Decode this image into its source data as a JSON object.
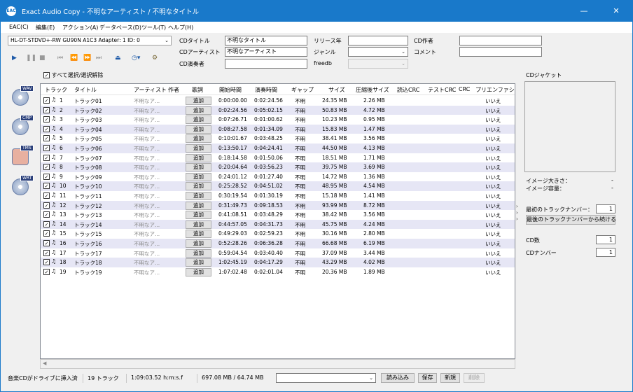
{
  "window": {
    "title": "Exact Audio Copy  -  不明なアーティスト / 不明なタイトル",
    "app_icon_text": "EAC"
  },
  "menu": [
    "EAC(C)",
    "編集(E)",
    "アクション(A)",
    "データベース(D)",
    "ツール(T)",
    "ヘルプ(H)"
  ],
  "drive": {
    "selected": "HL-DT-STDVD+-RW GU90N  A1C3   Adapter: 1  ID: 0"
  },
  "fields": {
    "cd_title_label": "CDタイトル",
    "cd_title_value": "不明なタイトル",
    "cd_artist_label": "CDアーティスト",
    "cd_artist_value": "不明なアーティスト",
    "cd_performer_label": "CD演奏者",
    "cd_performer_value": "",
    "release_year_label": "リリース年",
    "release_year_value": "",
    "genre_label": "ジャンル",
    "genre_value": "",
    "freedb_label": "freedb",
    "freedb_value": "",
    "cd_composer_label": "CD作者",
    "cd_composer_value": "",
    "comment_label": "コメント",
    "comment_value": ""
  },
  "select_all_label": "すべて選択/選択解除",
  "side_icons": [
    {
      "tag": "WAV"
    },
    {
      "tag": "CMP"
    },
    {
      "tag": "TMS"
    },
    {
      "tag": "WRT"
    }
  ],
  "columns": [
    "トラック",
    "タイトル",
    "アーティスト",
    "作者",
    "歌詞",
    "開始時間",
    "演奏時間",
    "ギャップ",
    "サイズ",
    "圧縮後サイズ",
    "読込CRC",
    "テストCRC",
    "CRC",
    "プリエンファシス"
  ],
  "add_label": "追加",
  "tracks": [
    {
      "no": "1",
      "title": "トラック01",
      "artist": "不明なア...",
      "start": "0:00:00.00",
      "length": "0:02:24.56",
      "gap": "不明",
      "size": "24.35 MB",
      "csize": "2.26 MB",
      "pre": "いいえ"
    },
    {
      "no": "2",
      "title": "トラック02",
      "artist": "不明なア...",
      "start": "0:02:24.56",
      "length": "0:05:02.15",
      "gap": "不明",
      "size": "50.83 MB",
      "csize": "4.72 MB",
      "pre": "いいえ"
    },
    {
      "no": "3",
      "title": "トラック03",
      "artist": "不明なア...",
      "start": "0:07:26.71",
      "length": "0:01:00.62",
      "gap": "不明",
      "size": "10.23 MB",
      "csize": "0.95 MB",
      "pre": "いいえ"
    },
    {
      "no": "4",
      "title": "トラック04",
      "artist": "不明なア...",
      "start": "0:08:27.58",
      "length": "0:01:34.09",
      "gap": "不明",
      "size": "15.83 MB",
      "csize": "1.47 MB",
      "pre": "いいえ"
    },
    {
      "no": "5",
      "title": "トラック05",
      "artist": "不明なア...",
      "start": "0:10:01.67",
      "length": "0:03:48.25",
      "gap": "不明",
      "size": "38.41 MB",
      "csize": "3.56 MB",
      "pre": "いいえ"
    },
    {
      "no": "6",
      "title": "トラック06",
      "artist": "不明なア...",
      "start": "0:13:50.17",
      "length": "0:04:24.41",
      "gap": "不明",
      "size": "44.50 MB",
      "csize": "4.13 MB",
      "pre": "いいえ"
    },
    {
      "no": "7",
      "title": "トラック07",
      "artist": "不明なア...",
      "start": "0:18:14.58",
      "length": "0:01:50.06",
      "gap": "不明",
      "size": "18.51 MB",
      "csize": "1.71 MB",
      "pre": "いいえ"
    },
    {
      "no": "8",
      "title": "トラック08",
      "artist": "不明なア...",
      "start": "0:20:04.64",
      "length": "0:03:56.23",
      "gap": "不明",
      "size": "39.75 MB",
      "csize": "3.69 MB",
      "pre": "いいえ"
    },
    {
      "no": "9",
      "title": "トラック09",
      "artist": "不明なア...",
      "start": "0:24:01.12",
      "length": "0:01:27.40",
      "gap": "不明",
      "size": "14.72 MB",
      "csize": "1.36 MB",
      "pre": "いいえ"
    },
    {
      "no": "10",
      "title": "トラック10",
      "artist": "不明なア...",
      "start": "0:25:28.52",
      "length": "0:04:51.02",
      "gap": "不明",
      "size": "48.95 MB",
      "csize": "4.54 MB",
      "pre": "いいえ"
    },
    {
      "no": "11",
      "title": "トラック11",
      "artist": "不明なア...",
      "start": "0:30:19.54",
      "length": "0:01:30.19",
      "gap": "不明",
      "size": "15.18 MB",
      "csize": "1.41 MB",
      "pre": "いいえ"
    },
    {
      "no": "12",
      "title": "トラック12",
      "artist": "不明なア...",
      "start": "0:31:49.73",
      "length": "0:09:18.53",
      "gap": "不明",
      "size": "93.99 MB",
      "csize": "8.72 MB",
      "pre": "いいえ"
    },
    {
      "no": "13",
      "title": "トラック13",
      "artist": "不明なア...",
      "start": "0:41:08.51",
      "length": "0:03:48.29",
      "gap": "不明",
      "size": "38.42 MB",
      "csize": "3.56 MB",
      "pre": "いいえ"
    },
    {
      "no": "14",
      "title": "トラック14",
      "artist": "不明なア...",
      "start": "0:44:57.05",
      "length": "0:04:31.73",
      "gap": "不明",
      "size": "45.75 MB",
      "csize": "4.24 MB",
      "pre": "いいえ"
    },
    {
      "no": "15",
      "title": "トラック15",
      "artist": "不明なア...",
      "start": "0:49:29.03",
      "length": "0:02:59.23",
      "gap": "不明",
      "size": "30.16 MB",
      "csize": "2.80 MB",
      "pre": "いいえ"
    },
    {
      "no": "16",
      "title": "トラック16",
      "artist": "不明なア...",
      "start": "0:52:28.26",
      "length": "0:06:36.28",
      "gap": "不明",
      "size": "66.68 MB",
      "csize": "6.19 MB",
      "pre": "いいえ"
    },
    {
      "no": "17",
      "title": "トラック17",
      "artist": "不明なア...",
      "start": "0:59:04.54",
      "length": "0:03:40.40",
      "gap": "不明",
      "size": "37.09 MB",
      "csize": "3.44 MB",
      "pre": "いいえ"
    },
    {
      "no": "18",
      "title": "トラック18",
      "artist": "不明なア...",
      "start": "1:02:45.19",
      "length": "0:04:17.29",
      "gap": "不明",
      "size": "43.29 MB",
      "csize": "4.02 MB",
      "pre": "いいえ"
    },
    {
      "no": "19",
      "title": "トラック19",
      "artist": "不明なア...",
      "start": "1:07:02.48",
      "length": "0:02:01.04",
      "gap": "不明",
      "size": "20.36 MB",
      "csize": "1.89 MB",
      "pre": "いいえ"
    }
  ],
  "right_panel": {
    "jacket_label": "CDジャケット",
    "image_size_label": "イメージ大きさ：",
    "image_size_value": "-",
    "image_capacity_label": "イメージ容量：",
    "image_capacity_value": "-",
    "first_track_label": "最初のトラックナンバー：",
    "first_track_value": "1",
    "continue_button": "最後のトラックナンバーから続ける",
    "cd_count_label": "CD数",
    "cd_count_value": "1",
    "cd_number_label": "CDナンバー",
    "cd_number_value": "1"
  },
  "status": {
    "message": "音楽CDがドライブに挿入済",
    "tracks": "19 トラック",
    "length": "1:09:03.52 h:m:s.f",
    "size": "697.08 MB / 64.74 MB",
    "btn_load": "読み込み",
    "btn_save": "保存",
    "btn_new": "新規",
    "btn_delete": "削除"
  },
  "colors": {
    "titlebar": "#1979ca",
    "alt_row": "#e6e6f5"
  }
}
